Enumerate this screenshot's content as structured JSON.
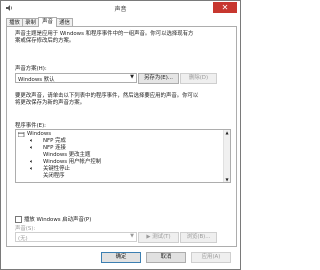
{
  "window": {
    "title": "声音",
    "close_glyph": "✕"
  },
  "tabs": [
    {
      "label": "播放",
      "active": false
    },
    {
      "label": "录制",
      "active": false
    },
    {
      "label": "声音",
      "active": true
    },
    {
      "label": "通信",
      "active": false
    }
  ],
  "panel": {
    "description_lines": [
      "声音主题是应用于 Windows 和程序事件中的一组声音。你可以选择现有方",
      "案或保存修改后的方案。"
    ],
    "scheme_label": "声音方案(H):",
    "scheme_value": "Windows 默认",
    "save_as_label": "另存为(E)...",
    "delete_label": "删除(D)",
    "change_info_lines": [
      "要更改声音，请单击以下列表中的程序事件，然后选择要应用的声音。你可以",
      "将更改保存为新的声音方案。"
    ],
    "events_label": "程序事件(E):",
    "events": [
      {
        "label": "Windows",
        "level": 0,
        "has_sound": false
      },
      {
        "label": "NFP 完成",
        "level": 1,
        "has_sound": true
      },
      {
        "label": "NFP 连接",
        "level": 1,
        "has_sound": true
      },
      {
        "label": "Windows 更改主题",
        "level": 1,
        "has_sound": false
      },
      {
        "label": "Windows 用户帐户控制",
        "level": 1,
        "has_sound": true
      },
      {
        "label": "关键性停止",
        "level": 1,
        "has_sound": true
      },
      {
        "label": "关闭程序",
        "level": 1,
        "has_sound": false
      }
    ],
    "startup_checkbox_label": "播放 Windows 启动声音(P)",
    "sounds_label": "声音(S):",
    "sound_value": "(无)",
    "test_label": "测试(T)",
    "browse_label": "浏览(B)..."
  },
  "footer": {
    "ok_label": "确定",
    "cancel_label": "取消",
    "apply_label": "应用(A)"
  },
  "colors": {
    "close_bg": "#c7372f",
    "default_border": "#3c7fb1"
  }
}
